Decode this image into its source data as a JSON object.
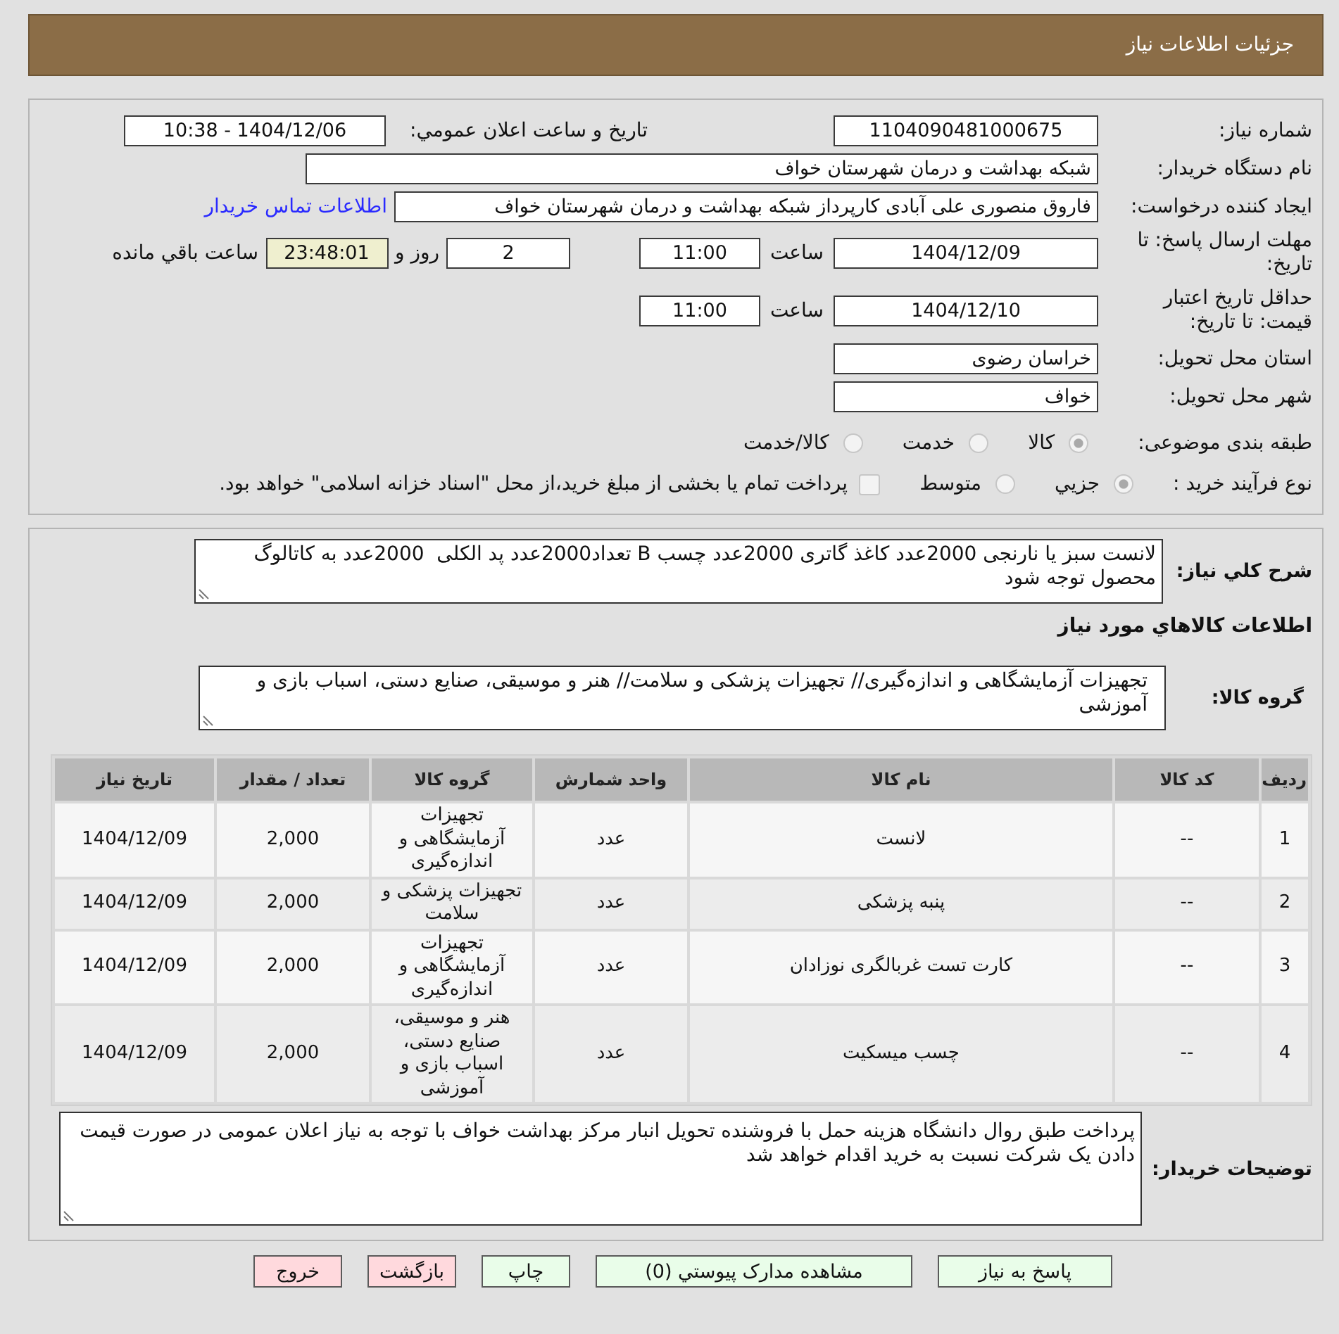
{
  "header": {
    "title": "جزئیات اطلاعات نیاز"
  },
  "details": {
    "need_number": {
      "label": "شماره نیاز:",
      "value": "1104090481000675"
    },
    "announcement": {
      "label": "تاریخ و ساعت اعلان عمومي:",
      "value": "1404/12/06 - 10:38"
    },
    "buyer_org": {
      "label": "نام دستگاه خریدار:",
      "value": "شبکه بهداشت و درمان شهرستان خواف"
    },
    "requester": {
      "label": "ایجاد کننده درخواست:",
      "value": "فاروق منصوری علی آبادی کارپرداز شبکه بهداشت و درمان شهرستان خواف",
      "link": "اطلاعات تماس خریدار"
    },
    "response_deadline": {
      "label": "مهلت ارسال پاسخ: تا تاریخ:",
      "date": "1404/12/09",
      "time_label": "ساعت",
      "time": "11:00",
      "days": "2",
      "days_label": "روز و",
      "remaining": "23:48:01",
      "remaining_label": "ساعت باقي مانده"
    },
    "price_validity": {
      "label": "حداقل تاریخ اعتبار قیمت: تا تاریخ:",
      "date": "1404/12/10",
      "time_label": "ساعت",
      "time": "11:00"
    },
    "province": {
      "label": "استان محل تحویل:",
      "value": "خراسان رضوی"
    },
    "city": {
      "label": "شهر محل تحویل:",
      "value": "خواف"
    },
    "category": {
      "label": "طبقه بندی موضوعی:",
      "options": [
        {
          "label": "کالا",
          "selected": true,
          "disabled": true
        },
        {
          "label": "خدمت",
          "selected": false,
          "disabled": true
        },
        {
          "label": "کالا/خدمت",
          "selected": false,
          "disabled": true
        }
      ]
    },
    "process": {
      "label": "نوع فرآیند خرید :",
      "options": [
        {
          "label": "جزيي",
          "selected": true,
          "disabled": true
        },
        {
          "label": "متوسط",
          "selected": false,
          "disabled": true
        }
      ],
      "treasury": {
        "label": "پرداخت تمام یا بخشی از مبلغ خرید،از محل \"اسناد خزانه اسلامی\" خواهد بود.",
        "checked": false,
        "disabled": true
      }
    }
  },
  "description": {
    "label": "شرح کلي نیاز:",
    "value": "لانست سبز یا نارنجی 2000عدد کاغذ گاتری 2000عدد چسب B تعداد2000عدد پد الکلی  2000عدد به کاتالوگ محصول توجه شود"
  },
  "goods": {
    "title": "اطلاعات کالاهاي مورد نیاز",
    "group_label": "گروه کالا:",
    "group_value": "تجهیزات آزمایشگاهی و اندازه‌گیری// تجهیزات پزشکی و سلامت// هنر و موسیقی، صنایع دستی، اسباب بازی و آموزشی"
  },
  "table": {
    "columns": [
      "ردیف",
      "کد کالا",
      "نام کالا",
      "واحد شمارش",
      "گروه کالا",
      "تعداد / مقدار",
      "تاریخ نیاز"
    ],
    "rows": [
      [
        "1",
        "--",
        "لانست",
        "عدد",
        "تجهیزات آزمایشگاهی و اندازه‌گیری",
        "2,000",
        "1404/12/09"
      ],
      [
        "2",
        "--",
        "پنبه پزشکی",
        "عدد",
        "تجهیزات پزشکی و سلامت",
        "2,000",
        "1404/12/09"
      ],
      [
        "3",
        "--",
        "کارت تست غربالگری نوزادان",
        "عدد",
        "تجهیزات آزمایشگاهی و اندازه‌گیری",
        "2,000",
        "1404/12/09"
      ],
      [
        "4",
        "--",
        "چسب میسکیت",
        "عدد",
        "هنر و موسیقی، صنایع دستی، اسباب بازی و آموزشی",
        "2,000",
        "1404/12/09"
      ]
    ]
  },
  "buyer_notes": {
    "label": "توضیحات خریدار:",
    "value": "پرداخت طبق روال دانشگاه هزینه حمل با فروشنده تحویل انبار مرکز بهداشت خواف با توجه به نیاز اعلان عمومی در صورت قیمت دادن یک شرکت نسبت به خرید اقدام خواهد شد"
  },
  "buttons": [
    {
      "label": "پاسخ به نیاز",
      "kind": "action"
    },
    {
      "label": "مشاهده مدارک پیوستي (0)",
      "kind": "action"
    },
    {
      "label": "چاپ",
      "kind": "action"
    },
    {
      "label": "بازگشت",
      "kind": "exit"
    },
    {
      "label": "خروج",
      "kind": "exit"
    }
  ]
}
